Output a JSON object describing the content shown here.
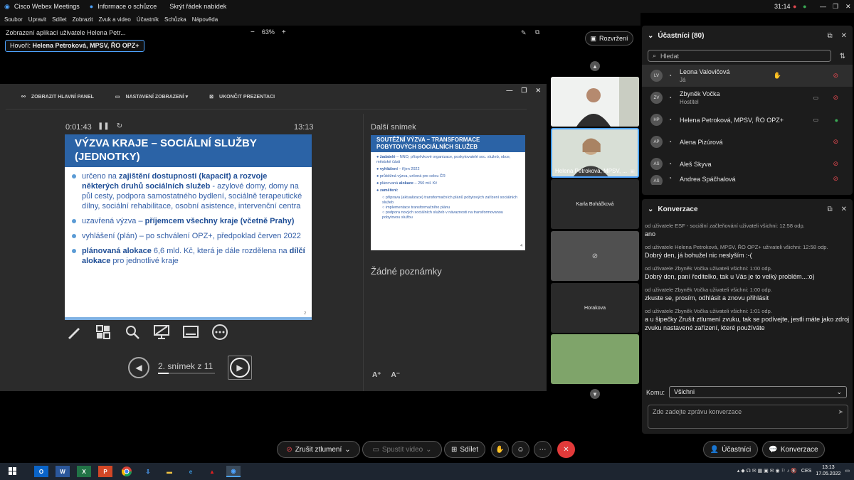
{
  "titlebar": {
    "app": "Cisco Webex Meetings",
    "info": "Informace o schůzce",
    "hide_menu": "Skrýt řádek nabídek",
    "time": "31:14"
  },
  "menu": [
    "Soubor",
    "Upravit",
    "Sdílet",
    "Zobrazit",
    "Zvuk a video",
    "Účastník",
    "Schůzka",
    "Nápověda"
  ],
  "view": {
    "title": "Zobrazení aplikací uživatele Helena Petr...",
    "zoom_minus": "−",
    "zoom": "63%",
    "zoom_plus": "+",
    "speaker_prefix": "Hovoří:",
    "speaker_name": "Helena Petroková, MPSV, ŘO OPZ+",
    "layout_btn": "Rozvržení"
  },
  "presenter": {
    "toolbar": {
      "main_panel": "ZOBRAZIT HLAVNÍ PANEL",
      "display_settings": "NASTAVENÍ ZOBRAZENÍ ▾",
      "end_presentation": "UKONČIT PREZENTACI"
    },
    "elapsed": "0:01:43",
    "clock": "13:13",
    "slide": {
      "title": "VÝZVA KRAJE – SOCIÁLNÍ SLUŽBY (JEDNOTKY)",
      "b1_a": "určeno na ",
      "b1_b": "zajištění dostupnosti (kapacit) a rozvoje některých druhů sociálních služeb",
      "b1_c": " - azylové domy, domy na půl cesty, podpora samostatného bydlení, sociálně terapeutické dílny, sociální rehabilitace, osobní asistence, intervenční centra",
      "b2_a": "uzavřená výzva – ",
      "b2_b": "příjemcem všechny kraje (včetně Prahy)",
      "b3": "vyhlášení (plán) – po schválení OPZ+, předpoklad červen 2022",
      "b4_a": "plánovaná alokace",
      "b4_b": " 6,6 mld. Kč, která je dále rozdělena na ",
      "b4_c": "dílčí alokace",
      "b4_d": " pro jednotlivé kraje",
      "page": "2"
    },
    "slide_counter": "2. snímek z 11",
    "next_label": "Další snímek",
    "next_slide": {
      "title": "SOUTĚŽNÍ VÝZVA – TRANSFORMACE POBYTOVÝCH SOCIÁLNÍCH SLUŽEB",
      "l1_a": "žadatelé",
      "l1_b": " – NNO, příspěvkové organizace, poskytovatelé soc. služeb, obce, městské části",
      "l2_a": "vyhlášení",
      "l2_b": " – říjen 2022",
      "l3": "průběžná výzva, určená pro celou ČR",
      "l4_a": "plánovaná ",
      "l4_b": "alokace",
      "l4_c": " – 250 mil. Kč",
      "l5": "zaměření:",
      "s1": "příprava (aktualizace) transformačních plánů pobytových zařízení sociálních služeb",
      "s2": "implementace transformačního plánu",
      "s3": "podpora nových sociálních služeb v návaznosti na transformovanou pobytovou službu",
      "page": "4"
    },
    "notes": "Žádné poznámky"
  },
  "videos": {
    "tile2_name": "Helena Petroková, MPSV, ...",
    "tile3_name": "Karla Boháčková",
    "tile5_name": "Horakova"
  },
  "participants": {
    "title": "Účastníci (80)",
    "search_placeholder": "Hledat",
    "list": [
      {
        "initials": "LV",
        "name": "Leona Valovičová",
        "role": "Já"
      },
      {
        "initials": "ZV",
        "name": "Zbyněk Vočka",
        "role": "Hostitel"
      },
      {
        "initials": "HP",
        "name": "Helena Petroková, MPSV, ŘO OPZ+",
        "role": ""
      },
      {
        "initials": "AP",
        "name": "Alena Pizúrová",
        "role": ""
      },
      {
        "initials": "AS",
        "name": "Aleš Skyva",
        "role": ""
      },
      {
        "initials": "AS",
        "name": "Andrea Spáčhalová",
        "role": ""
      }
    ]
  },
  "chat": {
    "title": "Konverzace",
    "messages": [
      {
        "meta": "od uživatele ESF - sociální začleňování uživateli všichni:   12:58 odp.",
        "text": "ano"
      },
      {
        "meta": "od uživatele Helena Petroková, MPSV, ŘO OPZ+ uživateli všichni:   12:58 odp.",
        "text": "Dobrý den, já bohužel nic neslyším :-("
      },
      {
        "meta": "od uživatele Zbyněk Vočka uživateli všichni:   1:00 odp.",
        "text": "Dobrý den, paní ředitelko, tak u Vás je to velký problém...:o)"
      },
      {
        "meta": "od uživatele Zbyněk Vočka uživateli všichni:   1:00 odp.",
        "text": "zkuste se, prosím, odhlásit a znovu přihlásit"
      },
      {
        "meta": "od uživatele Zbyněk Vočka uživateli všichni:   1:01 odp.",
        "text": "a u šipečky Zrušit ztlumení zvuku, tak se podívejte, jestli máte jako zdroj zvuku nastavené zařízení, které používáte"
      }
    ],
    "to_label": "Komu:",
    "to_value": "Všichni",
    "input_placeholder": "Zde zadejte zprávu konverzace"
  },
  "controls": {
    "unmute": "Zrušit ztlumení",
    "start_video": "Spustit video",
    "share": "Sdílet",
    "participants": "Účastníci",
    "chat": "Konverzace"
  },
  "taskbar": {
    "lang": "CES",
    "time": "13:13",
    "date": "17.05.2022"
  },
  "colors": {
    "accent": "#4da3ff",
    "muted_red": "#e0484f",
    "end_call": "#e23a3a",
    "slide_blue": "#2b63a6"
  }
}
